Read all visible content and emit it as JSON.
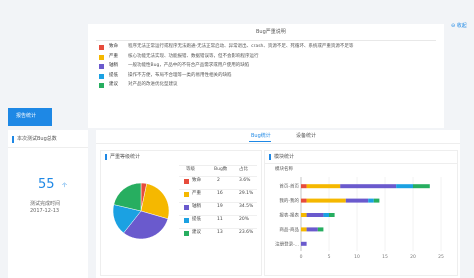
{
  "legend_card": {
    "title": "Bug严重说明",
    "collapse_label": "收起",
    "items": [
      {
        "color": "#e74c3c",
        "name": "致命",
        "desc": "程序无法正常运行或程序无法跑通-无法正常启动、异常退出、crash、资源不足、死循环、系统或严重资源不足等"
      },
      {
        "color": "#f5b800",
        "name": "严重",
        "desc": "核心功能无法实现、功能报错、数据错误等，但不会影响程序运行"
      },
      {
        "color": "#6a5acd",
        "name": "轴稍",
        "desc": "一般功能性Bug，产品中的不符合产品需求或用户使用的缺陷"
      },
      {
        "color": "#1ba1e2",
        "name": "提低",
        "desc": "操作不方便，布局不合理等一类的易用性相关的缺陷"
      },
      {
        "color": "#27ae60",
        "name": "建议",
        "desc": "对产品的改进优化型建议"
      }
    ]
  },
  "tab_active": "报告统计",
  "left_panel": {
    "title": "本次测试Bug总数",
    "count": "55",
    "unit": "个",
    "label": "测试完成时间",
    "date": "2017-12-13"
  },
  "subtabs": [
    "Bug统计",
    "设备统计"
  ],
  "pie_panel": {
    "title": "严重等级统计",
    "headers": [
      "等级",
      "Bug数",
      "占比"
    ],
    "rows": [
      {
        "color": "#e74c3c",
        "name": "致命",
        "count": "2",
        "pct": "3.6%"
      },
      {
        "color": "#f5b800",
        "name": "严重",
        "count": "16",
        "pct": "29.1%"
      },
      {
        "color": "#6a5acd",
        "name": "轴稍",
        "count": "19",
        "pct": "34.5%"
      },
      {
        "color": "#1ba1e2",
        "name": "提低",
        "count": "11",
        "pct": "20%"
      },
      {
        "color": "#27ae60",
        "name": "建议",
        "count": "13",
        "pct": "23.6%"
      }
    ]
  },
  "bar_panel": {
    "title": "模块统计",
    "column_header": "模块名称"
  },
  "chart_data": [
    {
      "type": "pie",
      "categories": [
        "致命",
        "严重",
        "轴稍",
        "提低",
        "建议"
      ],
      "values": [
        2,
        16,
        19,
        11,
        13
      ],
      "colors": [
        "#e74c3c",
        "#f5b800",
        "#6a5acd",
        "#1ba1e2",
        "#27ae60"
      ]
    },
    {
      "type": "bar",
      "orientation": "horizontal-stacked",
      "categories": [
        "首页-首页",
        "我的-我的",
        "报表-报表",
        "商品-商品",
        "注册登录-..."
      ],
      "series": [
        {
          "name": "致命",
          "color": "#e74c3c",
          "values": [
            1,
            1,
            0,
            0,
            0
          ]
        },
        {
          "name": "严重",
          "color": "#f5b800",
          "values": [
            6,
            7,
            1,
            1,
            0
          ]
        },
        {
          "name": "轴稍",
          "color": "#6a5acd",
          "values": [
            10,
            4,
            3,
            2,
            1
          ]
        },
        {
          "name": "提低",
          "color": "#1ba1e2",
          "values": [
            3,
            1,
            1,
            0,
            0
          ]
        },
        {
          "name": "建议",
          "color": "#27ae60",
          "values": [
            3,
            1,
            1,
            1,
            0
          ]
        }
      ],
      "xticks": [
        "0",
        "5",
        "10",
        "15",
        "20",
        "25"
      ],
      "xlim": [
        0,
        25
      ]
    }
  ]
}
